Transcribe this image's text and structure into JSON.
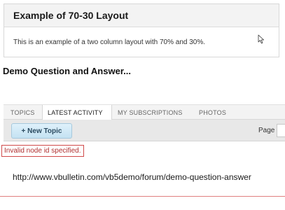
{
  "example": {
    "title": "Example of 70-30 Layout",
    "description": "This is an example of a two column layout with 70% and 30%."
  },
  "demo": {
    "title": "Demo Question and Answer..."
  },
  "tabs": [
    {
      "label": "TOPICS"
    },
    {
      "label": "LATEST ACTIVITY",
      "active": true
    },
    {
      "label": "MY SUBSCRIPTIONS"
    },
    {
      "label": "PHOTOS"
    }
  ],
  "toolbar": {
    "new_topic_label": "+ New Topic",
    "page_label": "Page",
    "page_value": ""
  },
  "error": {
    "message": "Invalid node id specified."
  },
  "url": {
    "text": "http://www.vbulletin.com/vb5demo/forum/demo-question-answer"
  },
  "icons": {
    "cursor": "mouse-pointer-icon"
  },
  "colors": {
    "error": "#b03030",
    "button_accent": "#c4e2f2"
  }
}
